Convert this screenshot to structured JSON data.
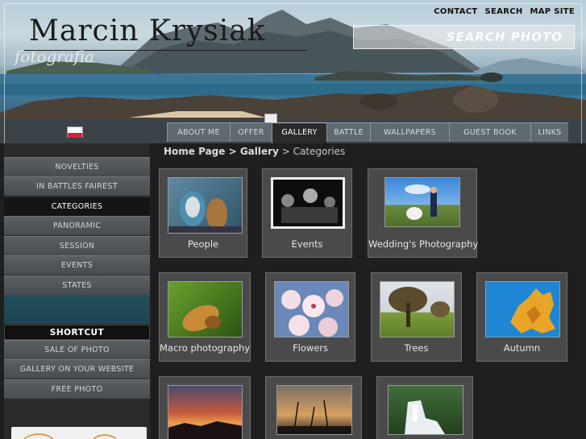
{
  "header": {
    "logo_name": "Marcin Krysiak",
    "logo_sub": "fotografia",
    "top_links": [
      "CONTACT",
      "SEARCH",
      "MAP SITE"
    ],
    "search_placeholder": "SEARCH PHOTO"
  },
  "nav": {
    "tabs": [
      {
        "label": "ABOUT ME",
        "active": false
      },
      {
        "label": "OFFER",
        "active": false
      },
      {
        "label": "GALLERY",
        "active": true
      },
      {
        "label": "BATTLE",
        "active": false
      },
      {
        "label": "WALLPAPERS",
        "active": false
      },
      {
        "label": "GUEST BOOK",
        "active": false
      },
      {
        "label": "LINKS",
        "active": false
      }
    ]
  },
  "sidebar": {
    "items": [
      "NOVELTIES",
      "IN BATTLES FAIREST",
      "CATEGORIES",
      "PANORAMIC",
      "SESSION",
      "EVENTS",
      "STATES"
    ],
    "active_item": "CATEGORIES",
    "shortcut_title": "SHORTCUT",
    "shortcut_items": [
      "SALE OF PHOTO",
      "GALLERY ON YOUR WEBSITE",
      "FREE PHOTO"
    ]
  },
  "breadcrumb": {
    "home": "Home Page",
    "sep1": " > ",
    "gallery": "Gallery",
    "sep2": " > ",
    "current": "Categories"
  },
  "categories": [
    {
      "label": "People",
      "icon": "people-photo"
    },
    {
      "label": "Events",
      "icon": "events-photo"
    },
    {
      "label": "Wedding's Photography",
      "icon": "wedding-photo"
    },
    {
      "label": "Macro photography",
      "icon": "macro-photo"
    },
    {
      "label": "Flowers",
      "icon": "flowers-photo"
    },
    {
      "label": "Trees",
      "icon": "trees-photo"
    },
    {
      "label": "Autumn",
      "icon": "autumn-photo"
    },
    {
      "label": "",
      "icon": "sunset-photo"
    },
    {
      "label": "",
      "icon": "dusk-photo"
    },
    {
      "label": "",
      "icon": "waterfall-photo"
    }
  ],
  "colors": {
    "background": "#1f1f1f",
    "card": "#4a4a4a",
    "tab": "#5e6a70",
    "flag_red": "#d4213d"
  }
}
